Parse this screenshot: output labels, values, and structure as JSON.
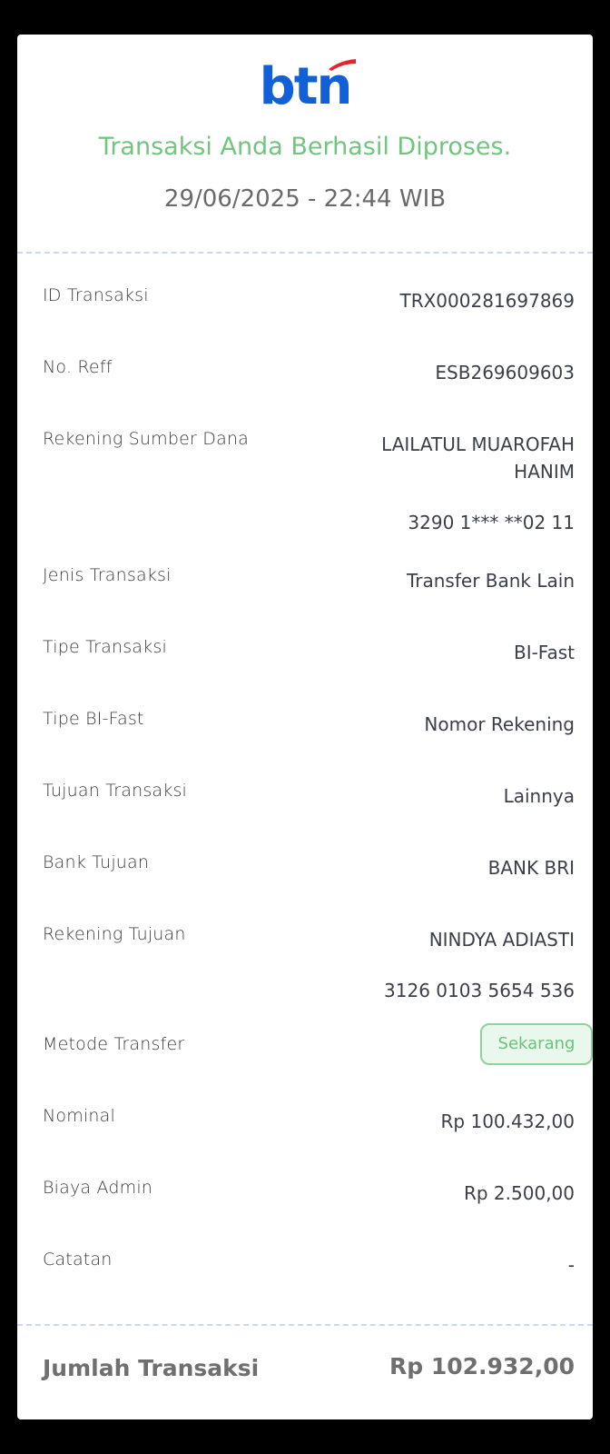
{
  "logo": {
    "text": "btn",
    "brand_color": "#1160d8",
    "accent_color": "#e3262b"
  },
  "header": {
    "status": "Transaksi Anda Berhasil Diproses.",
    "datetime": "29/06/2025 - 22:44 WIB"
  },
  "details": {
    "id_transaksi": {
      "label": "ID Transaksi",
      "value": "TRX000281697869"
    },
    "no_reff": {
      "label": "No. Reff",
      "value": "ESB269609603"
    },
    "rekening_sumber": {
      "label": "Rekening Sumber Dana",
      "name": "LAILATUL MUAROFAH HANIM",
      "number": "3290 1*** **02 11"
    },
    "jenis_transaksi": {
      "label": "Jenis Transaksi",
      "value": "Transfer Bank Lain"
    },
    "tipe_transaksi": {
      "label": "Tipe Transaksi",
      "value": "BI-Fast"
    },
    "tipe_bifast": {
      "label": "Tipe BI-Fast",
      "value": "Nomor Rekening"
    },
    "tujuan_transaksi": {
      "label": "Tujuan Transaksi",
      "value": "Lainnya"
    },
    "bank_tujuan": {
      "label": "Bank Tujuan",
      "value": "BANK BRI"
    },
    "rekening_tujuan": {
      "label": "Rekening Tujuan",
      "name": "NINDYA ADIASTI",
      "number": "3126 0103 5654 536"
    },
    "metode_transfer": {
      "label": "Metode Transfer",
      "value": "Sekarang"
    },
    "nominal": {
      "label": "Nominal",
      "value": "Rp 100.432,00"
    },
    "biaya_admin": {
      "label": "Biaya Admin",
      "value": "Rp 2.500,00"
    },
    "catatan": {
      "label": "Catatan",
      "value": "-"
    }
  },
  "total": {
    "label": "Jumlah Transaksi",
    "value": "Rp 102.932,00"
  },
  "colors": {
    "success": "#72c47f",
    "badge_border": "#8fd39a",
    "divider": "#c9d9ef"
  }
}
